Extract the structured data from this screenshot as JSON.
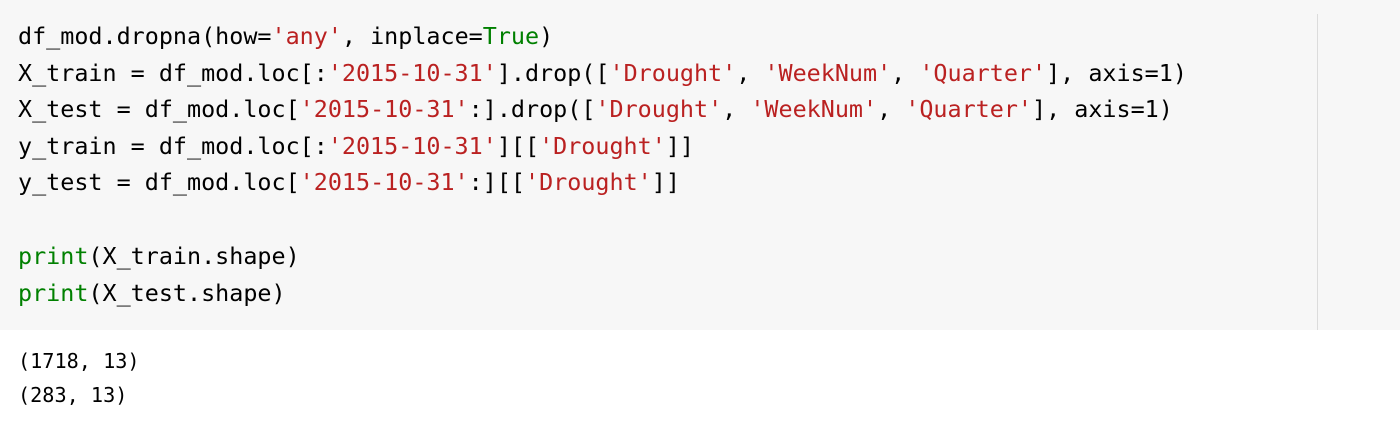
{
  "code_cell": {
    "lines": [
      [
        {
          "text": "df_mod.dropna(how=",
          "type": "plain"
        },
        {
          "text": "'any'",
          "type": "str"
        },
        {
          "text": ", inplace=",
          "type": "plain"
        },
        {
          "text": "True",
          "type": "kw"
        },
        {
          "text": ")",
          "type": "plain"
        }
      ],
      [
        {
          "text": "X_train = df_mod.loc[:",
          "type": "plain"
        },
        {
          "text": "'2015-10-31'",
          "type": "str"
        },
        {
          "text": "].drop([",
          "type": "plain"
        },
        {
          "text": "'Drought'",
          "type": "str"
        },
        {
          "text": ", ",
          "type": "plain"
        },
        {
          "text": "'WeekNum'",
          "type": "str"
        },
        {
          "text": ", ",
          "type": "plain"
        },
        {
          "text": "'Quarter'",
          "type": "str"
        },
        {
          "text": "], axis=1)",
          "type": "plain"
        }
      ],
      [
        {
          "text": "X_test = df_mod.loc[",
          "type": "plain"
        },
        {
          "text": "'2015-10-31'",
          "type": "str"
        },
        {
          "text": ":].drop([",
          "type": "plain"
        },
        {
          "text": "'Drought'",
          "type": "str"
        },
        {
          "text": ", ",
          "type": "plain"
        },
        {
          "text": "'WeekNum'",
          "type": "str"
        },
        {
          "text": ", ",
          "type": "plain"
        },
        {
          "text": "'Quarter'",
          "type": "str"
        },
        {
          "text": "], axis=1)",
          "type": "plain"
        }
      ],
      [
        {
          "text": "y_train = df_mod.loc[:",
          "type": "plain"
        },
        {
          "text": "'2015-10-31'",
          "type": "str"
        },
        {
          "text": "][[",
          "type": "plain"
        },
        {
          "text": "'Drought'",
          "type": "str"
        },
        {
          "text": "]]",
          "type": "plain"
        }
      ],
      [
        {
          "text": "y_test = df_mod.loc[",
          "type": "plain"
        },
        {
          "text": "'2015-10-31'",
          "type": "str"
        },
        {
          "text": ":][[",
          "type": "plain"
        },
        {
          "text": "'Drought'",
          "type": "str"
        },
        {
          "text": "]]",
          "type": "plain"
        }
      ],
      [],
      [
        {
          "text": "print",
          "type": "builtin"
        },
        {
          "text": "(X_train.shape)",
          "type": "plain"
        }
      ],
      [
        {
          "text": "print",
          "type": "builtin"
        },
        {
          "text": "(X_test.shape)",
          "type": "plain"
        }
      ]
    ],
    "colors": {
      "string": "#ba2121",
      "keyword": "#008000",
      "text": "#000000",
      "input_background": "#f7f7f7"
    }
  },
  "output": {
    "lines": [
      "(1718, 13)",
      "(283, 13)"
    ]
  }
}
